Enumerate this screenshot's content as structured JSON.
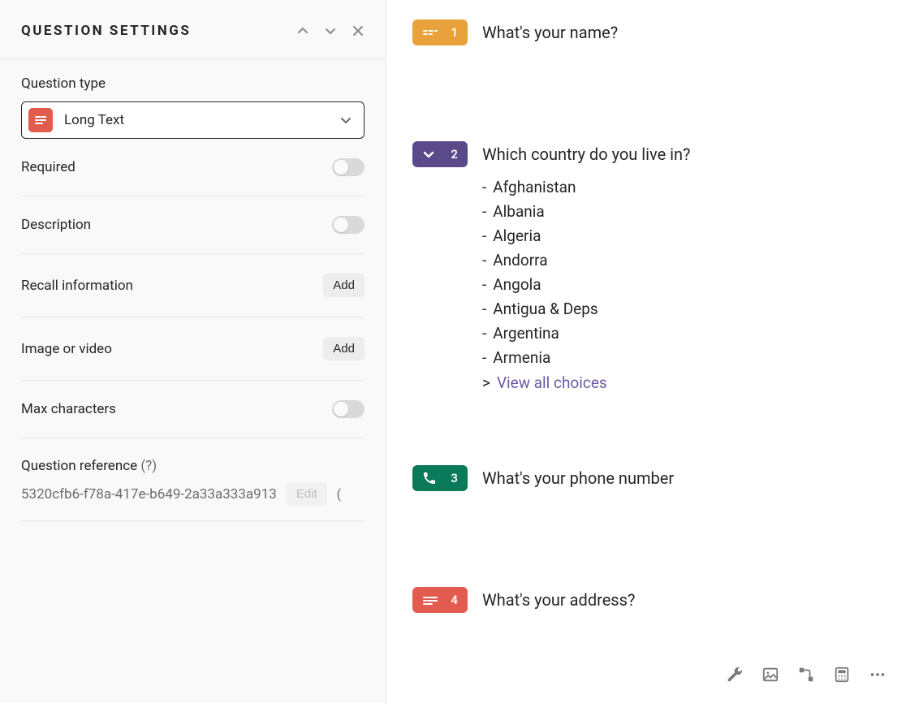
{
  "panel": {
    "title": "Question Settings",
    "question_type": {
      "label": "Question type",
      "selected": "Long Text"
    },
    "settings": {
      "required": {
        "label": "Required"
      },
      "description": {
        "label": "Description"
      },
      "recall": {
        "label": "Recall information",
        "button": "Add"
      },
      "media": {
        "label": "Image or video",
        "button": "Add"
      },
      "max_chars": {
        "label": "Max characters"
      }
    },
    "reference": {
      "label": "Question reference",
      "help": "(?)",
      "value": "5320cfb6-f78a-417e-b649-2a33a333a913",
      "edit": "Edit",
      "suffix": "("
    }
  },
  "questions": {
    "q1": {
      "num": "1",
      "title": "What's your name?"
    },
    "q2": {
      "num": "2",
      "title": "Which country do you live in?",
      "choices": [
        "Afghanistan",
        "Albania",
        "Algeria",
        "Andorra",
        "Angola",
        "Antigua & Deps",
        "Argentina",
        "Armenia"
      ],
      "view_all": "View all choices"
    },
    "q3": {
      "num": "3",
      "title": "What's your phone number"
    },
    "q4": {
      "num": "4",
      "title": "What's your address?"
    }
  }
}
